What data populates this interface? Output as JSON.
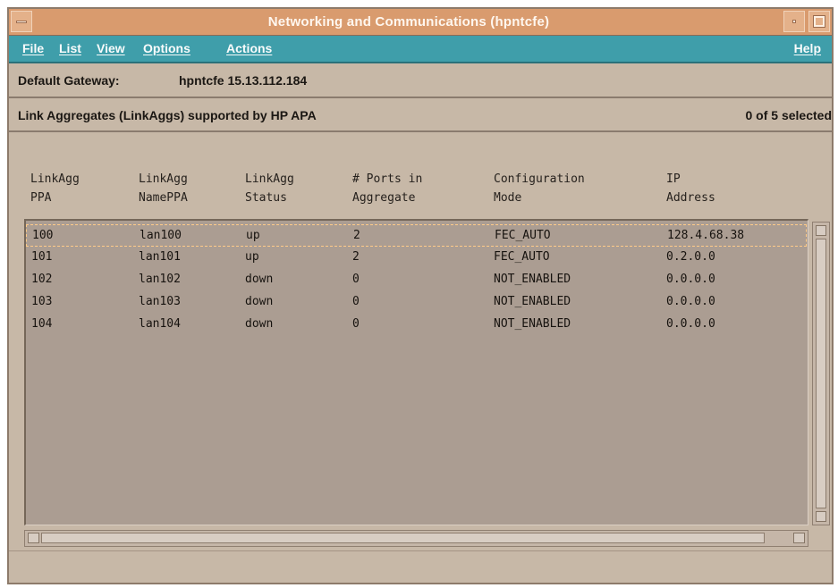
{
  "window": {
    "title": "Networking and Communications (hpntcfe)"
  },
  "menus": [
    {
      "label": "File"
    },
    {
      "label": "List"
    },
    {
      "label": "View"
    },
    {
      "label": "Options"
    },
    {
      "label": "Actions"
    },
    {
      "label": "Help"
    }
  ],
  "gateway": {
    "label": "Default Gateway:",
    "value": "hpntcfe  15.13.112.184"
  },
  "section": {
    "title": "Link Aggregates (LinkAggs) supported by HP APA",
    "selection": "0 of 5 selected"
  },
  "table": {
    "columns": [
      "LinkAgg\nPPA",
      "LinkAgg\nNamePPA",
      "LinkAgg\nStatus",
      "# Ports in\nAggregate",
      "Configuration\nMode",
      "IP\nAddress"
    ],
    "rows": [
      [
        "100",
        "lan100",
        "up",
        "2",
        "FEC_AUTO",
        "128.4.68.38"
      ],
      [
        "101",
        "lan101",
        "up",
        "2",
        "FEC_AUTO",
        "0.2.0.0"
      ],
      [
        "102",
        "lan102",
        "down",
        "0",
        "NOT_ENABLED",
        "0.0.0.0"
      ],
      [
        "103",
        "lan103",
        "down",
        "0",
        "NOT_ENABLED",
        "0.0.0.0"
      ],
      [
        "104",
        "lan104",
        "down",
        "0",
        "NOT_ENABLED",
        "0.0.0.0"
      ]
    ]
  },
  "icons": {
    "window_menu": "window-menu-icon",
    "minimize": "minimize-icon",
    "maximize": "maximize-icon",
    "scroll_up": "scroll-up-icon",
    "scroll_down": "scroll-down-icon",
    "scroll_left": "scroll-left-icon",
    "scroll_right": "scroll-right-icon"
  },
  "colors": {
    "titlebar": "#d99b6e",
    "menubar": "#3f9eaa",
    "window_bg": "#c7b8a7",
    "list_bg": "#ab9d92",
    "focus_outline": "#ffcb89"
  }
}
